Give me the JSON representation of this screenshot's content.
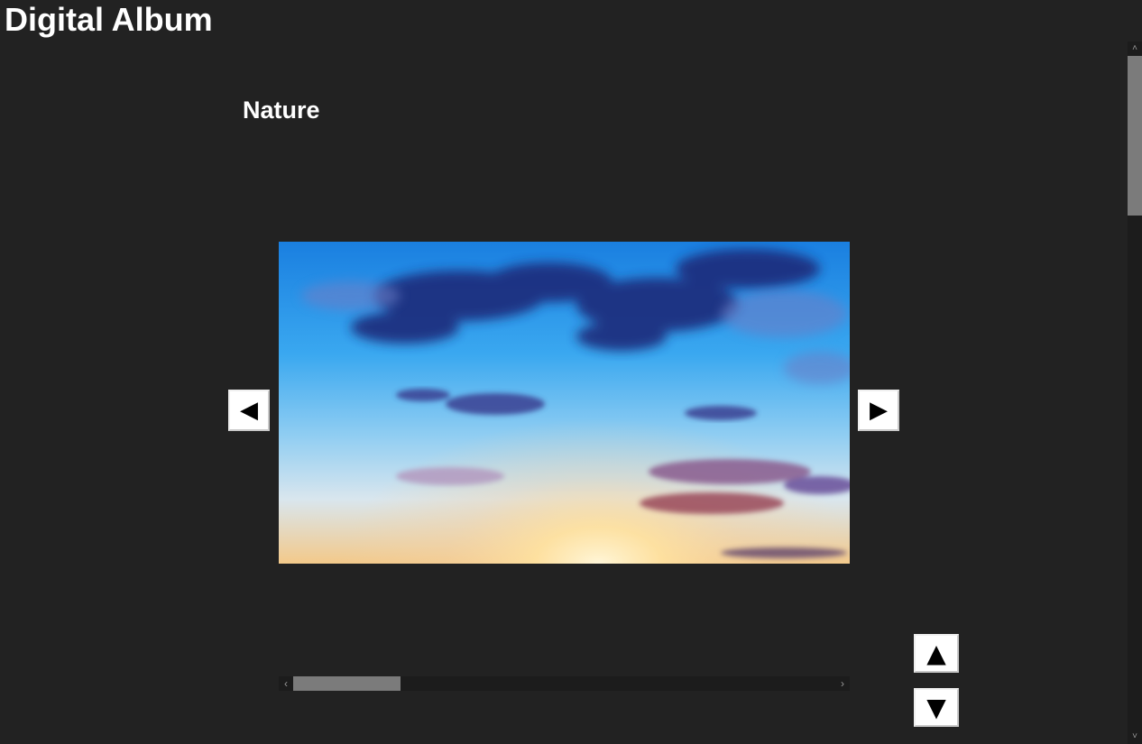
{
  "app": {
    "title": "Digital Album"
  },
  "album": {
    "name": "Nature"
  },
  "photo": {
    "subject": "sunset-sky-photo"
  },
  "controls": {
    "prev_label": "◀",
    "next_label": "▶",
    "up_label": "▲",
    "down_label": "▼"
  },
  "scrollbars": {
    "horizontal_left_arrow": "‹",
    "horizontal_right_arrow": "›",
    "vertical_up_arrow": "˄",
    "vertical_down_arrow": "˅"
  },
  "colors": {
    "background": "#222222",
    "text": "#ffffff",
    "button_bg": "#ffffff",
    "scroll_thumb": "#7b7b7b"
  }
}
